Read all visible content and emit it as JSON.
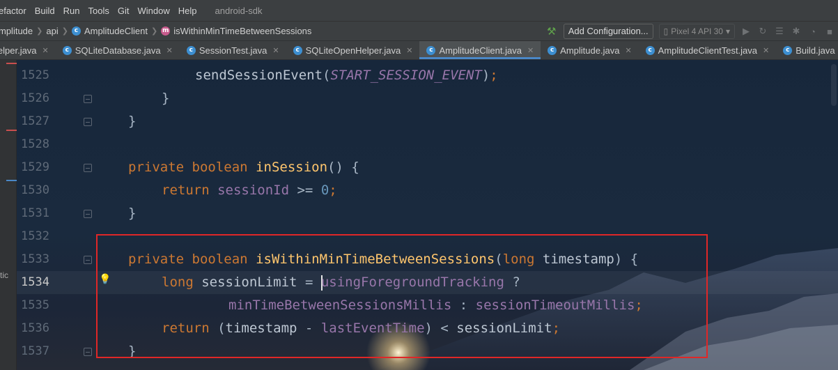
{
  "menu": {
    "items": [
      {
        "label": "efactor"
      },
      {
        "label": "Build"
      },
      {
        "label": "Run"
      },
      {
        "label": "Tools"
      },
      {
        "label": "Git"
      },
      {
        "label": "Window"
      },
      {
        "label": "Help"
      }
    ],
    "project_name": "android-sdk"
  },
  "breadcrumb": {
    "items": [
      "mplitude",
      "api",
      "AmplitudeClient",
      "isWithinMinTimeBetweenSessions"
    ]
  },
  "toolbar": {
    "build_icon": "hammer-icon",
    "add_configuration_label": "Add Configuration...",
    "device_label": "Pixel 4 API 30"
  },
  "tabs": [
    {
      "label": "lelper.java",
      "active": false
    },
    {
      "label": "SQLiteDatabase.java",
      "active": false
    },
    {
      "label": "SessionTest.java",
      "active": false
    },
    {
      "label": "SQLiteOpenHelper.java",
      "active": false
    },
    {
      "label": "AmplitudeClient.java",
      "active": true
    },
    {
      "label": "Amplitude.java",
      "active": false
    },
    {
      "label": "AmplitudeClientTest.java",
      "active": false
    },
    {
      "label": "Build.java",
      "active": false
    }
  ],
  "side_panel": {
    "partial_text": "tic"
  },
  "editor": {
    "current_line": "1534",
    "lines": [
      {
        "num": "1525",
        "code": "sendSessionEvent(START_SESSION_EVENT);"
      },
      {
        "num": "1526",
        "code": "}"
      },
      {
        "num": "1527",
        "code": "}"
      },
      {
        "num": "1528",
        "code": ""
      },
      {
        "num": "1529",
        "code": "private boolean inSession() {"
      },
      {
        "num": "1530",
        "code": "return sessionId >= 0;"
      },
      {
        "num": "1531",
        "code": "}"
      },
      {
        "num": "1532",
        "code": ""
      },
      {
        "num": "1533",
        "code": "private boolean isWithinMinTimeBetweenSessions(long timestamp) {"
      },
      {
        "num": "1534",
        "code": "long sessionLimit = usingForegroundTracking ?"
      },
      {
        "num": "1535",
        "code": "minTimeBetweenSessionsMillis : sessionTimeoutMillis;"
      },
      {
        "num": "1536",
        "code": "return (timestamp - lastEventTime) < sessionLimit;"
      },
      {
        "num": "1537",
        "code": "}"
      }
    ],
    "tokens": {
      "l1525_fn": "sendSessionEvent",
      "l1525_const": "START_SESSION_EVENT",
      "private": "private",
      "boolean": "boolean",
      "return": "return",
      "long": "long",
      "inSession": "inSession",
      "sessionId": "sessionId",
      "zero": "0",
      "isWithin": "isWithinMinTimeBetweenSessions",
      "timestamp": "timestamp",
      "sessionLimit": "sessionLimit",
      "usingFg": "usingForegroundTracking",
      "minTime": "minTimeBetweenSessionsMillis",
      "timeout": "sessionTimeoutMillis",
      "lastEventTime": "lastEventTime"
    }
  },
  "colors": {
    "highlight_box": "#e02727",
    "keyword": "#cc7832",
    "function": "#ffc66d",
    "field": "#9876aa",
    "number": "#6897bb"
  }
}
